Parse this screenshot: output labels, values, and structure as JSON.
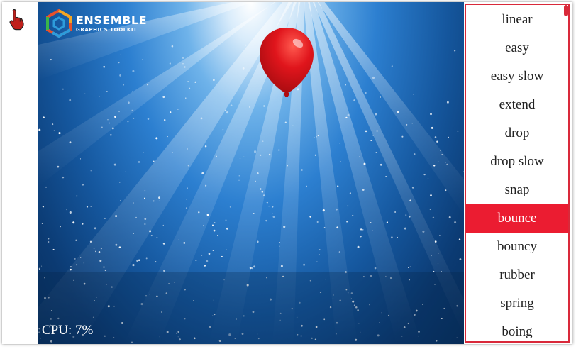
{
  "app": {
    "logo_title": "ENSEMBLE",
    "logo_subtitle": "GRAPHICS TOOLKIT",
    "cpu_label": "CPU: 7%"
  },
  "icons": {
    "cursor": "hand-pointer-icon",
    "logo": "ensemble-hexagon-logo-icon",
    "balloon": "red-balloon-icon"
  },
  "colors": {
    "accent": "#eb1c31",
    "menu_border": "#d9293a",
    "balloon": "#e0151c",
    "sky_dark": "#0b3a72",
    "sky_light": "#6fb3ea"
  },
  "easing_menu": {
    "selected": "bounce",
    "items": [
      {
        "label": "linear"
      },
      {
        "label": "easy"
      },
      {
        "label": "easy slow"
      },
      {
        "label": "extend"
      },
      {
        "label": "drop"
      },
      {
        "label": "drop slow"
      },
      {
        "label": "snap"
      },
      {
        "label": "bounce"
      },
      {
        "label": "bouncy"
      },
      {
        "label": "rubber"
      },
      {
        "label": "spring"
      },
      {
        "label": "boing"
      }
    ]
  }
}
